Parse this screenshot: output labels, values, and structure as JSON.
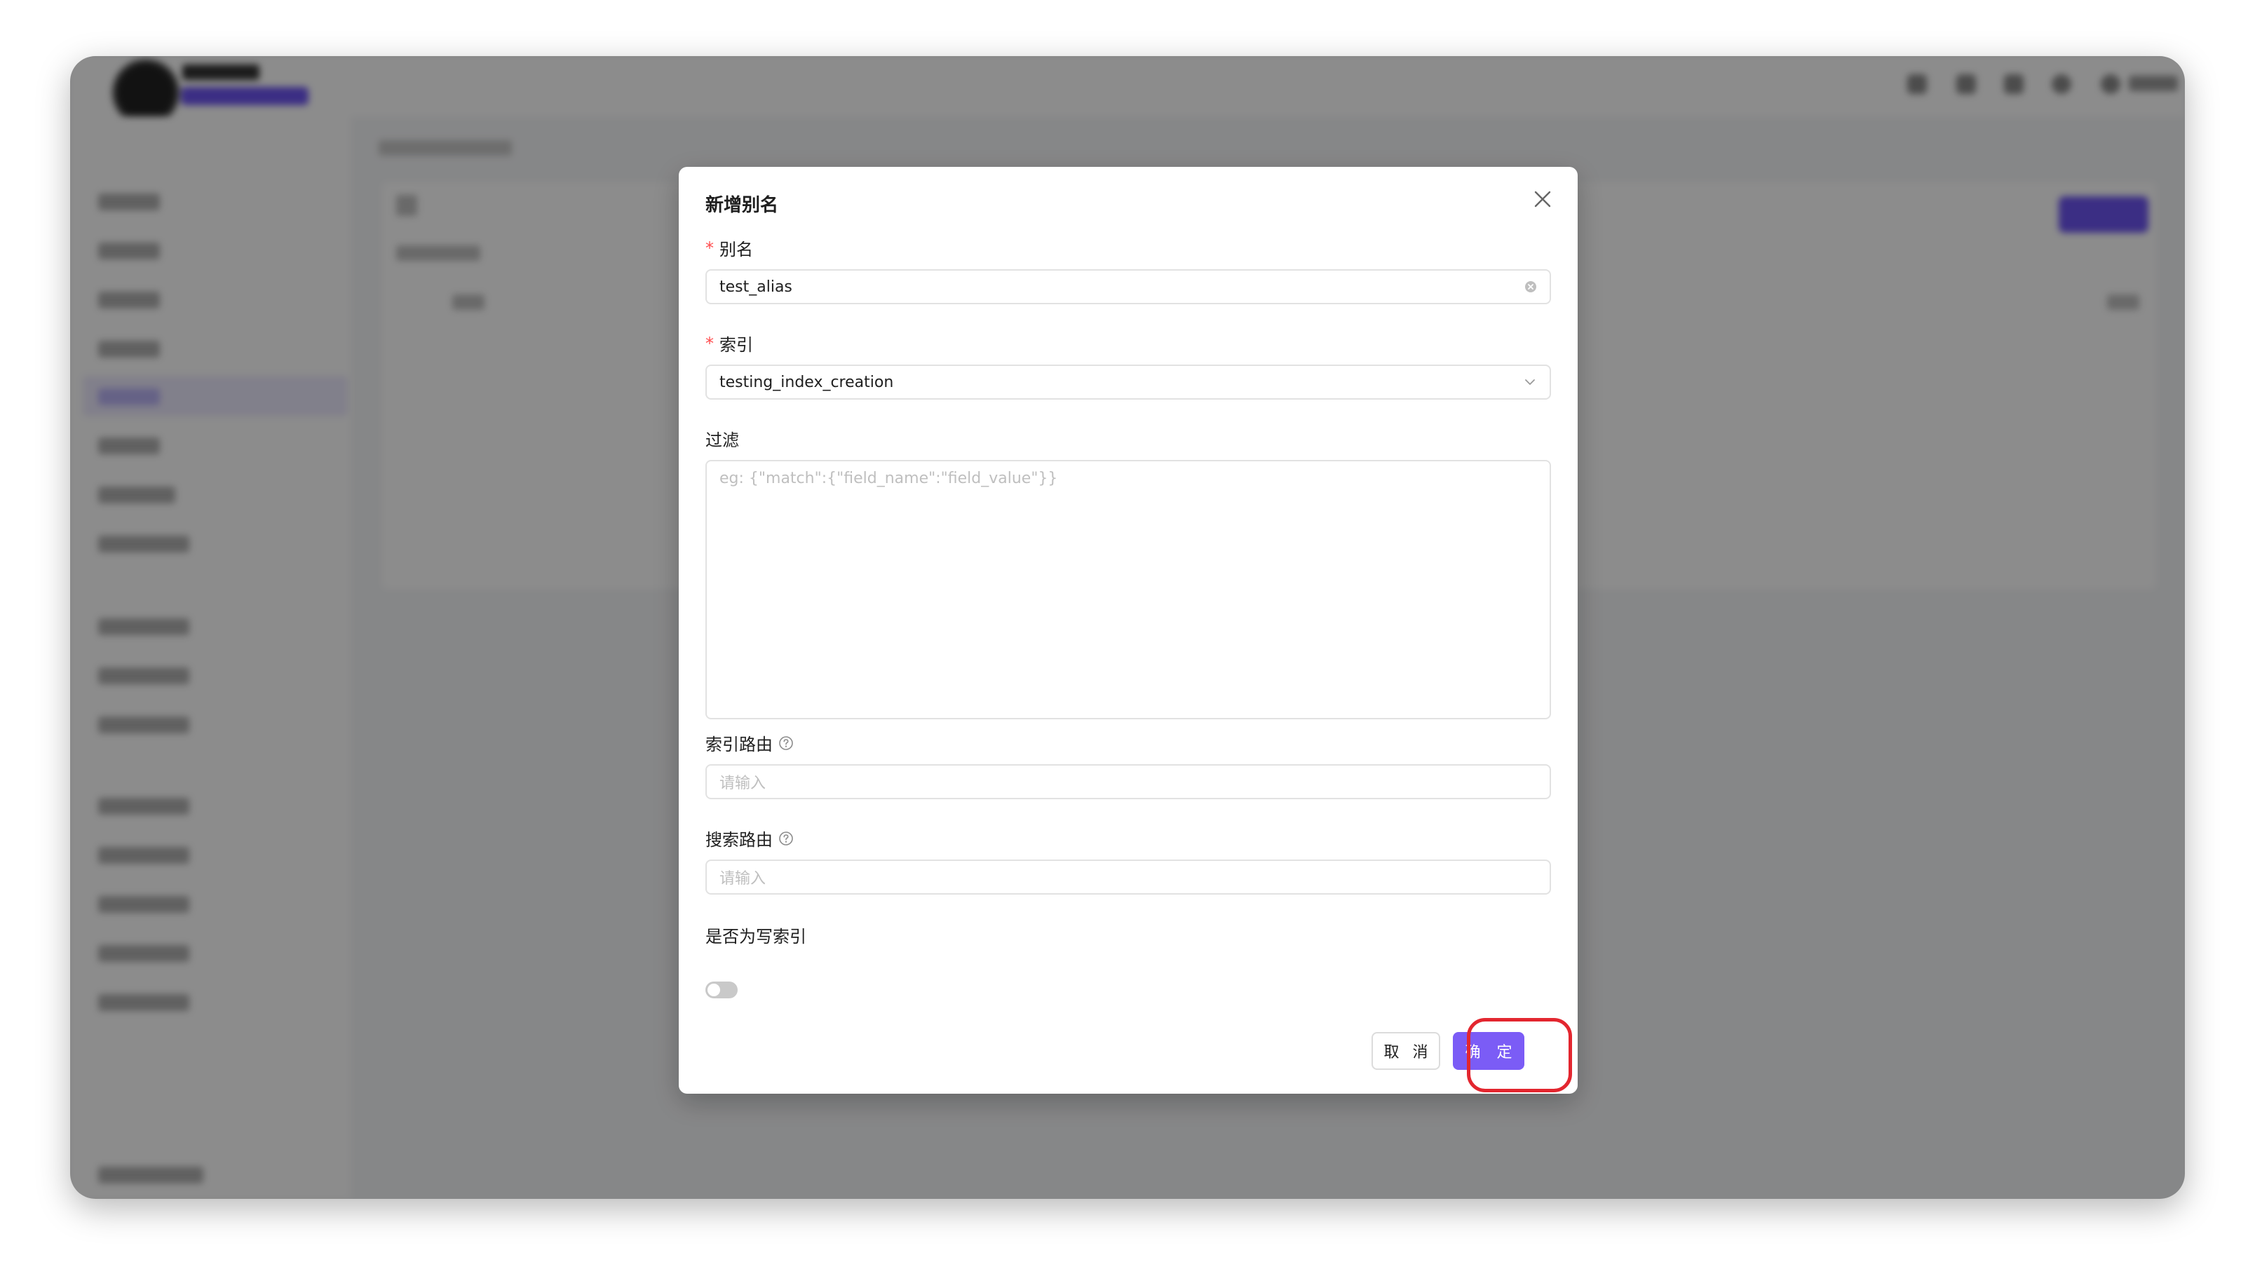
{
  "modal": {
    "title": "新增别名",
    "fields": {
      "alias": {
        "label": "别名",
        "required_mark": "*",
        "value": "test_alias"
      },
      "index": {
        "label": "索引",
        "required_mark": "*",
        "value": "testing_index_creation"
      },
      "filter": {
        "label": "过滤",
        "placeholder": "eg: {\"match\":{\"field_name\":\"field_value\"}}"
      },
      "index_routing": {
        "label": "索引路由",
        "placeholder": "请输入"
      },
      "search_routing": {
        "label": "搜索路由",
        "placeholder": "请输入"
      },
      "is_write_index": {
        "label": "是否为写索引",
        "checked": false
      }
    },
    "buttons": {
      "cancel": "取 消",
      "ok": "确 定"
    }
  },
  "colors": {
    "primary": "#7b5cf6",
    "required": "#ff4d4f",
    "highlight": "#e3262f",
    "overlay": "rgba(0,0,0,0.45)"
  }
}
